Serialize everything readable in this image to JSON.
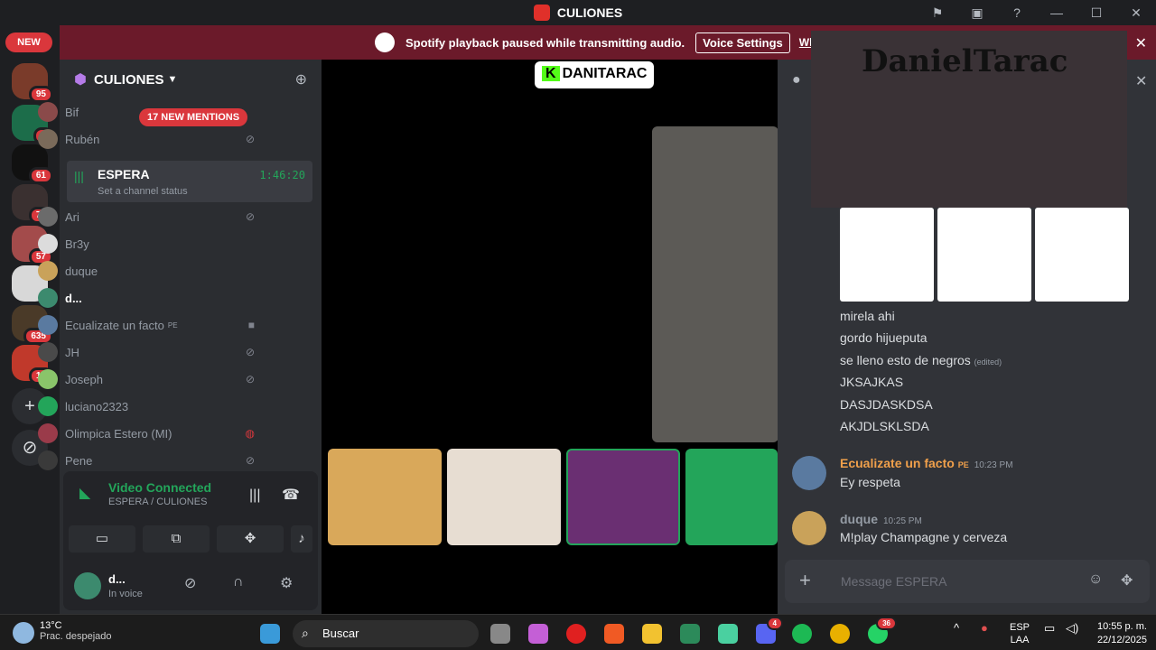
{
  "window": {
    "title": "CULIONES",
    "controls": [
      "⚑",
      "▣",
      "?",
      "—",
      "☐",
      "✕"
    ]
  },
  "banner": {
    "message": "Spotify playback paused while transmitting audio.",
    "voice_settings": "Voice Settings",
    "whats": "What's t"
  },
  "guilds": {
    "new_label": "NEW",
    "badges": [
      "95",
      "5",
      "61",
      "76",
      "57",
      "635",
      "17"
    ]
  },
  "sidebar": {
    "server_name": "CULIONES",
    "mentions": "17 NEW MENTIONS",
    "members_top": [
      "Bif",
      "Rubén"
    ],
    "channel": {
      "name": "ESPERA",
      "time": "1:46:20",
      "status": "Set a channel status"
    },
    "members": [
      "Ari",
      "Br3y",
      "duque",
      "d...",
      "Ecualizate un facto",
      "JH",
      "Joseph",
      "luciano2323",
      "Olimpica Estero (MI)",
      "Pene"
    ],
    "member_tag": "PE"
  },
  "voice": {
    "status": "Video Connected",
    "channel": "ESPERA / CULIONES",
    "user": "d...",
    "user_status": "In voice"
  },
  "stage": {
    "streamer": "DANITARAC",
    "kick_k": "K"
  },
  "chat": {
    "webcam_tag": "DanielTarac",
    "lines": [
      "mirela ahi",
      "gordo hijueputa",
      "se lleno esto de negros",
      "JKSAJKAS",
      "DASJDASKDSA",
      "AKJDLSKLSDA"
    ],
    "edited": "(edited)",
    "msg1": {
      "name": "Ecualizate un facto",
      "tag": "PE",
      "time": "10:23 PM",
      "text": "Ey respeta"
    },
    "msg2": {
      "name": "duque",
      "time": "10:25 PM",
      "text": "M!play Champagne y cerveza"
    },
    "placeholder": "Message ESPERA"
  },
  "taskbar": {
    "temp": "13°C",
    "weather": "Prac. despejado",
    "search": "Buscar",
    "lang1": "ESP",
    "lang2": "LAA",
    "time": "10:55 p. m.",
    "date": "22/12/2025",
    "badges": [
      "4",
      "36"
    ]
  }
}
